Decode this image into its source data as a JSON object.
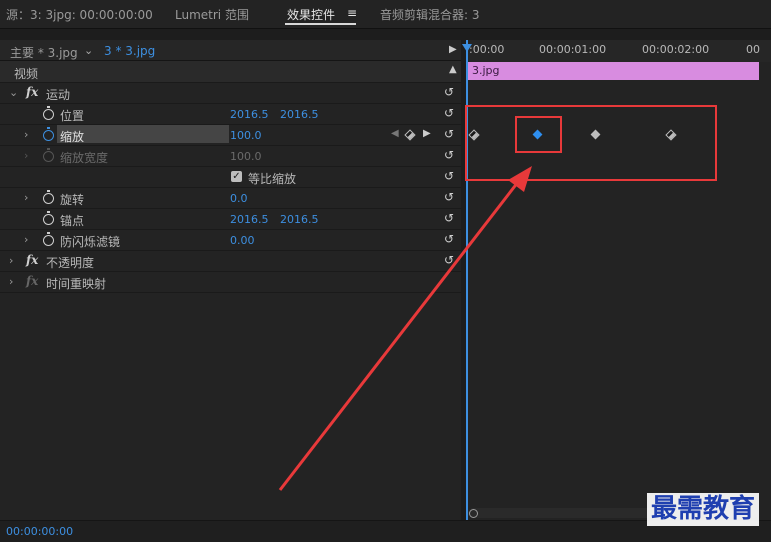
{
  "tabs": {
    "source": "源：3: 3jpg: 00:00:00:00",
    "lumetri": "Lumetri 范围",
    "effect_controls": "效果控件",
    "effect_controls_menu": "≡",
    "audio_mixer": "音频剪辑混合器: 3"
  },
  "subtabs": {
    "master": "主要 * 3.jpg",
    "sequence": "3 * 3.jpg"
  },
  "ruler": {
    "t0": ":00:00",
    "t1": "00:00:01:00",
    "t2": "00:00:02:00",
    "t3": "00"
  },
  "clip": {
    "name": "3.jpg"
  },
  "effects": {
    "video_label": "视频",
    "motion": {
      "label": "运动",
      "position": {
        "label": "位置",
        "x": "2016.5",
        "y": "2016.5"
      },
      "scale": {
        "label": "缩放",
        "value": "100.0"
      },
      "scale_width": {
        "label": "缩放宽度",
        "value": "100.0"
      },
      "uniform_scale": {
        "label": "等比缩放",
        "checked": true
      },
      "rotation": {
        "label": "旋转",
        "value": "0.0"
      },
      "anchor": {
        "label": "锚点",
        "x": "2016.5",
        "y": "2016.5"
      },
      "anti_flicker": {
        "label": "防闪烁滤镜",
        "value": "0.00"
      }
    },
    "opacity": {
      "label": "不透明度"
    },
    "time_remap": {
      "label": "时间重映射"
    }
  },
  "status": {
    "timecode": "00:00:00:00"
  },
  "watermark": "最需教育",
  "colors": {
    "accent": "#3d8fe0",
    "keyframe_selected": "#2e8ff0",
    "clip": "#d88ce0",
    "annotation": "#e8393a"
  },
  "icons": {
    "reset": "reset-icon",
    "stopwatch": "stopwatch-icon",
    "fx": "fx-icon",
    "keyframe": "keyframe-icon"
  }
}
